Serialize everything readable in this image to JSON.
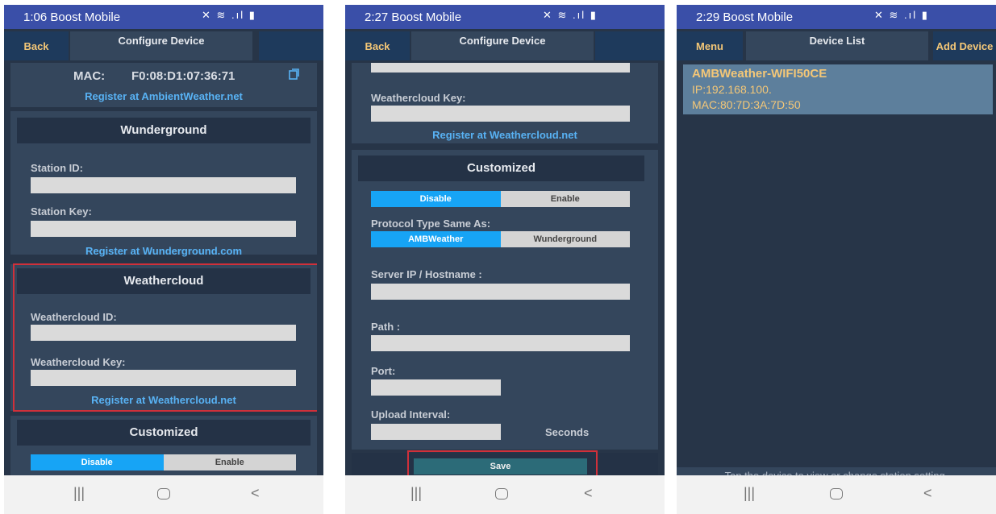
{
  "colors": {
    "statusbar": "#3a4fa8",
    "background": "#273548",
    "accent": "#17a4f5",
    "link": "#58b2f4",
    "highlight": "#d0303a",
    "nav_button_text": "#f4c777"
  },
  "phone1": {
    "status": {
      "time": "1:06",
      "carrier": "Boost Mobile"
    },
    "topbar": {
      "left": "Back",
      "title": "Configure Device"
    },
    "mac_label": "MAC:",
    "mac_value": "F0:08:D1:07:36:71",
    "copy_icon": "copy-icon",
    "register_ambient": "Register at AmbientWeather.net",
    "wunderground": {
      "header": "Wunderground",
      "station_id_label": "Station ID:",
      "station_key_label": "Station Key:",
      "register": "Register at Wunderground.com"
    },
    "weathercloud": {
      "header": "Weathercloud",
      "id_label": "Weathercloud ID:",
      "key_label": "Weathercloud Key:",
      "register": "Register at Weathercloud.net"
    },
    "customized": {
      "header": "Customized",
      "disable": "Disable",
      "enable": "Enable",
      "selected": "Disable"
    }
  },
  "phone2": {
    "status": {
      "time": "2:27",
      "carrier": "Boost Mobile"
    },
    "topbar": {
      "left": "Back",
      "title": "Configure Device"
    },
    "weathercloud_key_label": "Weathercloud Key:",
    "register_weathercloud": "Register at Weathercloud.net",
    "customized": {
      "header": "Customized",
      "disable": "Disable",
      "enable": "Enable",
      "selected": "Disable",
      "protocol_label": "Protocol Type Same As:",
      "protocol_ambweather": "AMBWeather",
      "protocol_wunderground": "Wunderground",
      "protocol_selected": "AMBWeather",
      "server_label": "Server IP / Hostname :",
      "path_label": "Path :",
      "port_label": "Port:",
      "interval_label": "Upload Interval:",
      "seconds": "Seconds"
    },
    "save": "Save"
  },
  "phone3": {
    "status": {
      "time": "2:29",
      "carrier": "Boost Mobile"
    },
    "topbar": {
      "left": "Menu",
      "title": "Device List",
      "right": "Add Device"
    },
    "device": {
      "name": "AMBWeather-WIFI50CE",
      "ip": "IP:192.168.100.",
      "mac": "MAC:80:7D:3A:7D:50"
    },
    "hint": "Tap the device to view or change station setting."
  },
  "navbar": {
    "recents": "|||",
    "home_icon": "home-icon",
    "back": "<"
  },
  "status_icons": "✕ ≋ .ıl ▮"
}
